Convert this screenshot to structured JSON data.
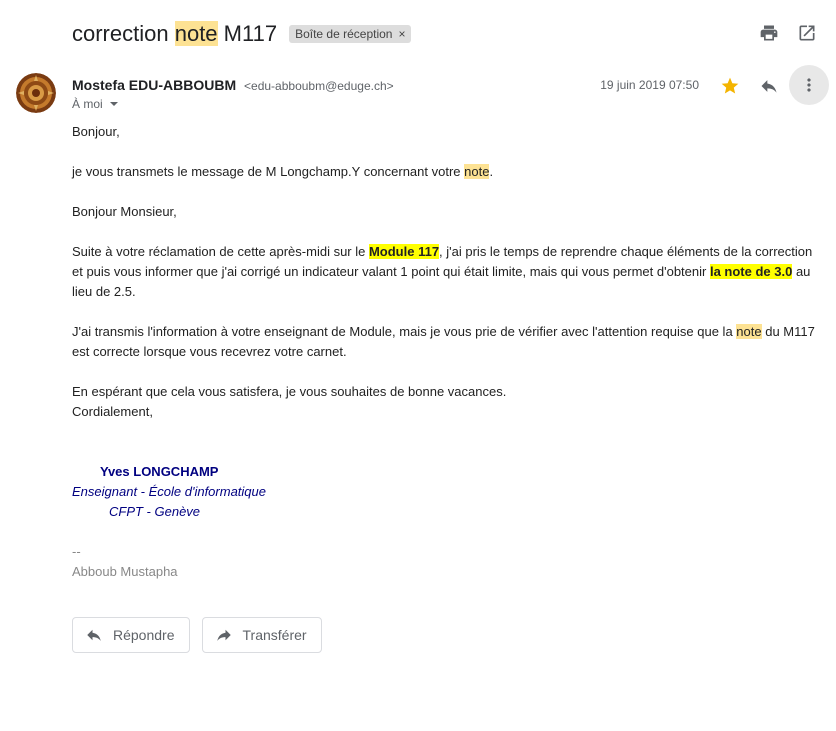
{
  "subject": {
    "before": "correction ",
    "highlight": "note",
    "after": " M117"
  },
  "label_chip": {
    "text": "Boîte de réception",
    "close": "×"
  },
  "sender": {
    "name": "Mostefa EDU-ABBOUBM",
    "email": "<edu-abboubm@eduge.ch>"
  },
  "recipient": {
    "text": "À moi"
  },
  "date": "19 juin 2019 07:50",
  "body": {
    "greeting": "Bonjour,",
    "line1_before": "je vous transmets le message de M Longchamp.Y concernant  votre ",
    "line1_highlight": "note",
    "line1_after": ".",
    "salutation": "Bonjour Monsieur,",
    "p2_a": "Suite à votre réclamation de cette après-midi sur le ",
    "p2_b": "Module 117",
    "p2_c": ", j'ai pris le temps de reprendre chaque éléments de la correction et puis vous informer que j'ai corrigé un indicateur valant 1 point qui était limite, mais qui vous permet d'obtenir ",
    "p2_d": "la note de 3.0",
    "p2_e": " au lieu de 2.5.",
    "p3_a": "J'ai transmis l'information à votre enseignant de Module, mais je vous prie de vérifier avec l'attention requise que la ",
    "p3_b": "note",
    "p3_c": " du M117 est correcte lorsque vous recevrez votre carnet.",
    "p4_line1": "En espérant que cela vous satisfera, je vous souhaites de bonne vacances.",
    "p4_line2": "Cordialement,"
  },
  "signature": {
    "name": "Yves LONGCHAMP",
    "role": "Enseignant - École d'informatique",
    "place": "CFPT - Genève"
  },
  "footer": {
    "dash": "--",
    "name": "Abboub Mustapha"
  },
  "actions": {
    "reply": "Répondre",
    "forward": "Transférer"
  },
  "icons": {
    "print": "print-icon",
    "open": "open-in-new-icon",
    "star": "star-icon",
    "reply": "reply-icon",
    "more": "more-vert-icon"
  },
  "colors": {
    "star": "#f4b400",
    "search_highlight": "#fde293",
    "yellow_highlight": "#ffff00",
    "signature": "#000080"
  }
}
